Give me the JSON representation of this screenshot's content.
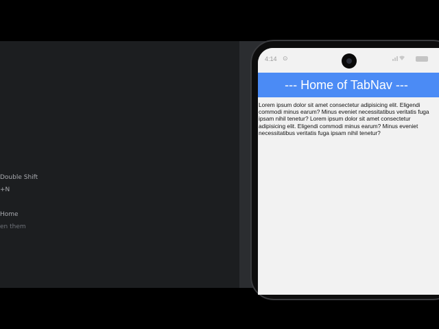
{
  "ide": {
    "hints": [
      {
        "text": "Double Shift"
      },
      {
        "text": "+N"
      },
      {
        "text": "Home"
      },
      {
        "text": "en them"
      }
    ]
  },
  "phone": {
    "status": {
      "time": "4:14",
      "extra": "⊙"
    },
    "appbar": {
      "title": "--- Home of TabNav ---"
    },
    "content": {
      "body": "Lorem ipsum dolor sit amet consectetur adipisicing elit. Eligendi commodi minus earum? Minus eveniet necessitatibus veritatis fuga ipsam nihil tenetur? Lorem ipsum dolor sit amet consectetur adipisicing elit. Eligendi commodi minus earum? Minus eveniet necessitatibus veritatis fuga ipsam nihil tenetur?"
    }
  },
  "colors": {
    "appbar": "#4b8bf5",
    "screen_bg": "#f2f2f2",
    "ide_bg": "#1c1e20"
  },
  "icons": [
    "wifi-icon",
    "signal-icon",
    "battery-icon",
    "camera-cutout-icon"
  ]
}
